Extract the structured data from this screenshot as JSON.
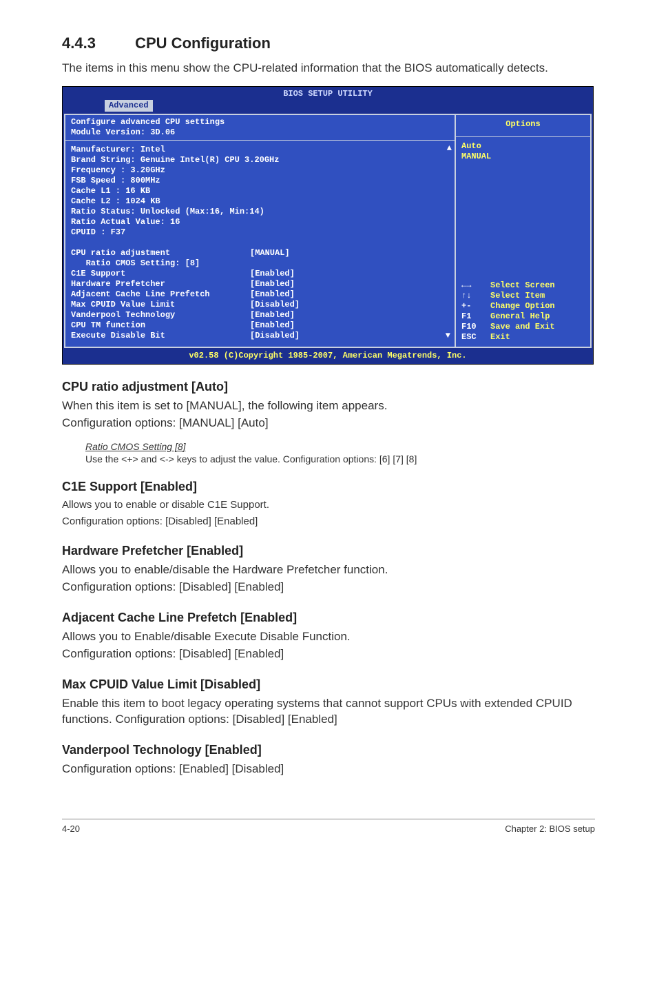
{
  "section": {
    "number": "4.4.3",
    "title": "CPU Configuration",
    "intro": "The items in this menu show the CPU-related information that the BIOS automatically detects."
  },
  "bios": {
    "header": "BIOS SETUP UTILITY",
    "tab": "Advanced",
    "left_top_line1": "Configure advanced CPU settings",
    "left_top_line2": "Module Version: 3D.06",
    "info": [
      "Manufacturer: Intel",
      "Brand String: Genuine Intel(R) CPU 3.20GHz",
      "Frequency   : 3.20GHz",
      "FSB Speed   : 800MHz",
      "Cache L1    : 16 KB",
      "Cache L2    : 1024 KB",
      "Ratio Status: Unlocked (Max:16, Min:14)",
      "Ratio Actual Value: 16",
      "CPUID       : F37"
    ],
    "settings": [
      {
        "label": "CPU ratio adjustment",
        "value": "[MANUAL]"
      },
      {
        "label": "   Ratio CMOS Setting: [8]",
        "value": ""
      },
      {
        "label": "C1E Support",
        "value": "[Enabled]"
      },
      {
        "label": "Hardware Prefetcher",
        "value": "[Enabled]"
      },
      {
        "label": "Adjacent Cache Line Prefetch",
        "value": "[Enabled]"
      },
      {
        "label": "Max CPUID Value Limit",
        "value": "[Disabled]"
      },
      {
        "label": "Vanderpool Technology",
        "value": "[Enabled]"
      },
      {
        "label": "CPU TM function",
        "value": "[Enabled]"
      },
      {
        "label": "Execute Disable Bit",
        "value": "[Disabled]"
      }
    ],
    "right_header": "Options",
    "right_options": [
      "Auto",
      "MANUAL"
    ],
    "help": [
      {
        "key": "←→",
        "text": "Select Screen"
      },
      {
        "key": "↑↓",
        "text": "Select Item"
      },
      {
        "key": "+-",
        "text": "Change Option"
      },
      {
        "key": "F1",
        "text": "General Help"
      },
      {
        "key": "F10",
        "text": "Save and Exit"
      },
      {
        "key": "ESC",
        "text": "Exit"
      }
    ],
    "footer": "v02.58 (C)Copyright 1985-2007, American Megatrends, Inc."
  },
  "subsections": {
    "cpu_ratio": {
      "title": "CPU ratio adjustment [Auto]",
      "body1": "When this item is set to [MANUAL], the following item appears.",
      "body2": "Configuration options: [MANUAL] [Auto]",
      "ratio_title": "Ratio CMOS Setting [8]",
      "ratio_body": "Use the <+> and <-> keys to adjust the value. Configuration options: [6] [7] [8]"
    },
    "c1e": {
      "title": "C1E Support [Enabled]",
      "body1": "Allows you to enable or disable C1E Support.",
      "body2": "Configuration options: [Disabled] [Enabled]"
    },
    "hw_prefetch": {
      "title": "Hardware Prefetcher [Enabled]",
      "body1": "Allows you to enable/disable the Hardware Prefetcher function.",
      "body2": "Configuration options: [Disabled] [Enabled]"
    },
    "adj_cache": {
      "title": "Adjacent Cache Line Prefetch [Enabled]",
      "body1": "Allows you to Enable/disable Execute Disable Function.",
      "body2": "Configuration options: [Disabled] [Enabled]"
    },
    "max_cpuid": {
      "title": "Max CPUID Value Limit [Disabled]",
      "body": "Enable this item to boot legacy operating systems that cannot support CPUs with extended CPUID functions. Configuration options: [Disabled] [Enabled]"
    },
    "vanderpool": {
      "title": "Vanderpool Technology [Enabled]",
      "body": "Configuration options: [Enabled] [Disabled]"
    }
  },
  "footer": {
    "left": "4-20",
    "right": "Chapter 2: BIOS setup"
  }
}
